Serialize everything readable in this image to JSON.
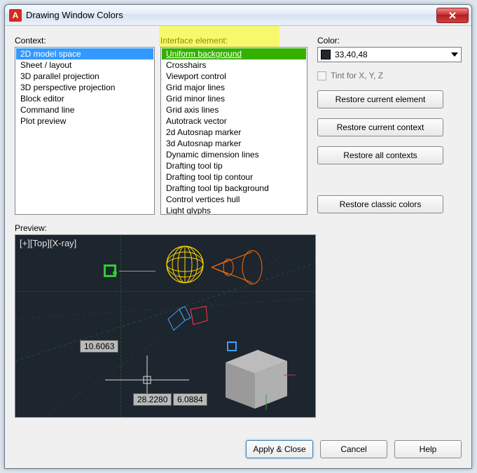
{
  "window": {
    "title": "Drawing Window Colors",
    "icon_letter": "A"
  },
  "labels": {
    "context": "Context:",
    "interface": "Interface element:",
    "color": "Color:",
    "preview": "Preview:"
  },
  "context_items": [
    "2D model space",
    "Sheet / layout",
    "3D parallel projection",
    "3D perspective projection",
    "Block editor",
    "Command line",
    "Plot preview"
  ],
  "context_selected": 0,
  "interface_items": [
    "Uniform background",
    "Crosshairs",
    "Viewport control",
    "Grid major lines",
    "Grid minor lines",
    "Grid axis lines",
    "Autotrack vector",
    "2d Autosnap marker",
    "3d Autosnap marker",
    "Dynamic dimension lines",
    "Drafting tool tip",
    "Drafting tool tip contour",
    "Drafting tool tip background",
    "Control vertices hull",
    "Light glyphs"
  ],
  "interface_selected": 0,
  "color": {
    "swatch": "#212830",
    "value": "33,40,48"
  },
  "tint_label": "Tint for X, Y, Z",
  "buttons": {
    "restore_element": "Restore current element",
    "restore_context": "Restore current context",
    "restore_all": "Restore all contexts",
    "restore_classic": "Restore classic colors",
    "apply": "Apply & Close",
    "cancel": "Cancel",
    "help": "Help"
  },
  "preview": {
    "overlay": "[+][Top][X-ray]",
    "readout1": "10.6063",
    "readout2": "28.2280",
    "readout3": "6.0884"
  }
}
